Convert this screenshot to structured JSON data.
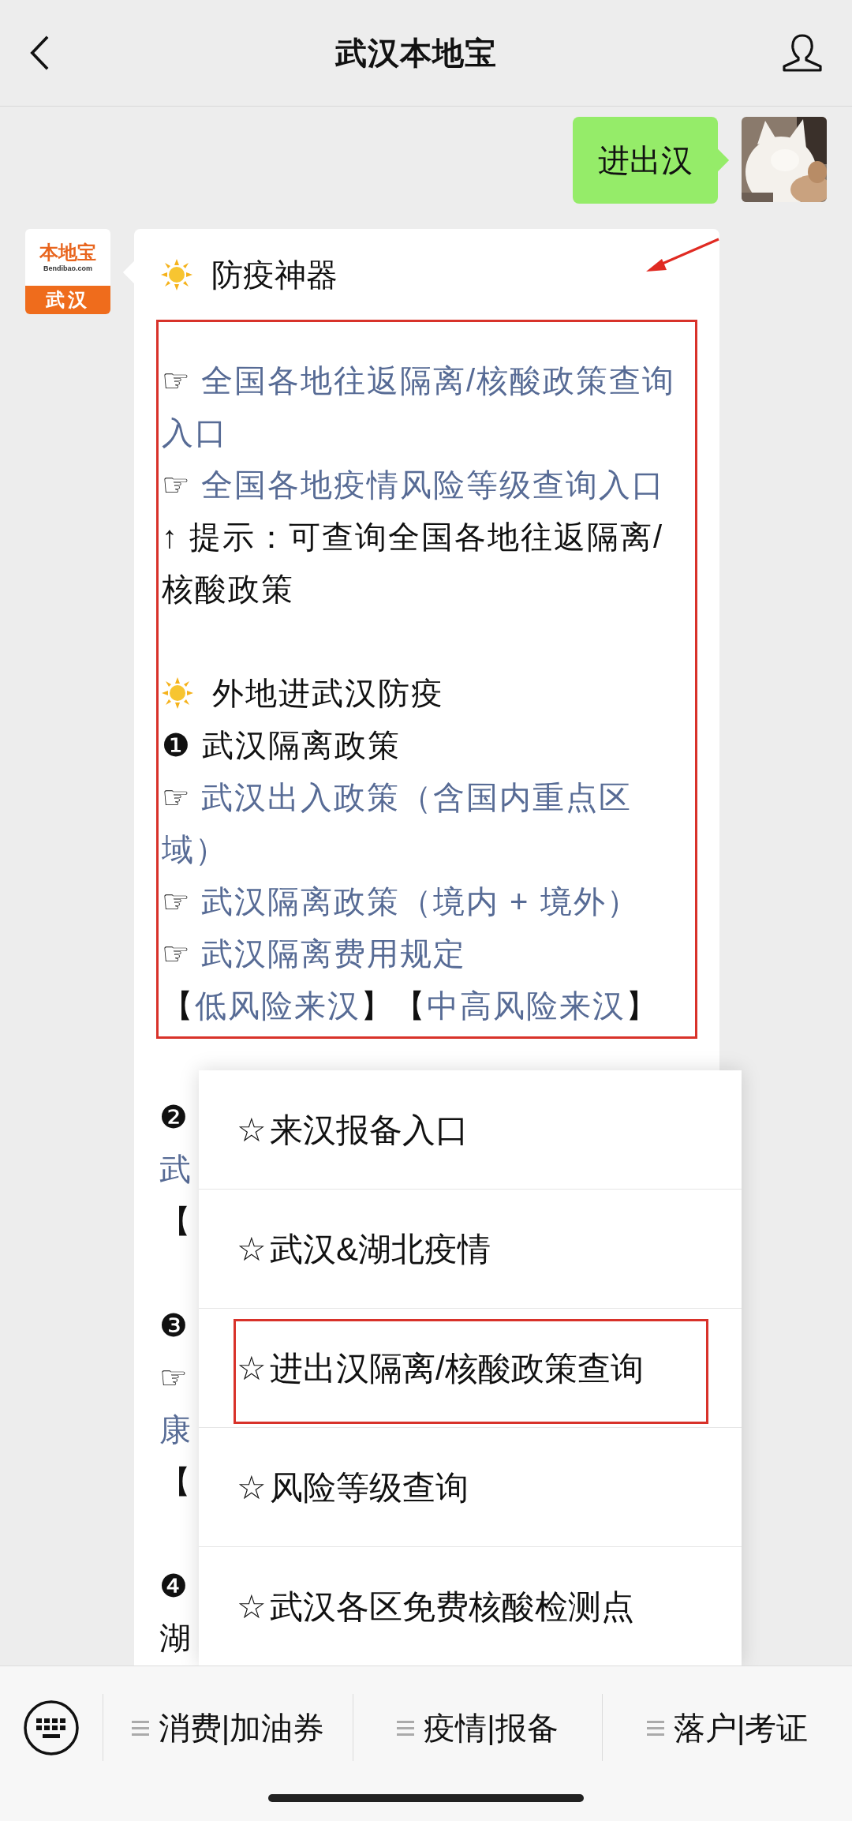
{
  "header": {
    "title": "武汉本地宝"
  },
  "sent_message": {
    "text": "进出汉"
  },
  "reply": {
    "logo": {
      "name": "本地宝",
      "site": "Bendibao.com",
      "city": "武汉"
    },
    "heading": "防疫神器",
    "highlighted_lines": [
      {
        "kind": "link",
        "prefix": "☞",
        "text": "全国各地往返隔离/核酸政策查询入口"
      },
      {
        "kind": "link",
        "prefix": "☞",
        "text": "全国各地疫情风险等级查询入口"
      },
      {
        "kind": "text",
        "text": "↑ 提示：可查询全国各地往返隔离/核酸政策"
      },
      {
        "kind": "blank"
      },
      {
        "kind": "heading",
        "text": "外地进武汉防疫"
      },
      {
        "kind": "text",
        "text": "❶ 武汉隔离政策"
      },
      {
        "kind": "link",
        "prefix": "☞",
        "text": "武汉出入政策（含国内重点区域）"
      },
      {
        "kind": "link",
        "prefix": "☞",
        "text": "武汉隔离政策（境内 + 境外）"
      },
      {
        "kind": "link",
        "prefix": "☞",
        "text": "武汉隔离费用规定"
      },
      {
        "kind": "parts",
        "parts": [
          {
            "text": "【",
            "kind": "text"
          },
          {
            "text": "低风险来汉",
            "kind": "link"
          },
          {
            "text": "】【",
            "kind": "text"
          },
          {
            "text": "中高风险来汉",
            "kind": "link"
          },
          {
            "text": "】",
            "kind": "text"
          }
        ]
      }
    ],
    "lines": [
      {
        "kind": "blank"
      },
      {
        "kind": "text",
        "text": "❷"
      },
      {
        "kind": "parts",
        "parts": [
          {
            "text": "武",
            "kind": "link"
          }
        ]
      },
      {
        "kind": "text",
        "text": "【"
      },
      {
        "kind": "blank"
      },
      {
        "kind": "text",
        "text": "❸"
      },
      {
        "kind": "text",
        "text": "☞"
      },
      {
        "kind": "parts",
        "parts": [
          {
            "text": "康",
            "kind": "link"
          }
        ]
      },
      {
        "kind": "text",
        "text": "【"
      },
      {
        "kind": "blank"
      },
      {
        "kind": "text",
        "text": "❹"
      },
      {
        "kind": "text",
        "text": "湖"
      }
    ]
  },
  "popup_menu": {
    "items": [
      {
        "icon": "☆",
        "label": "来汉报备入口",
        "highlighted": false
      },
      {
        "icon": "☆",
        "label": "武汉&湖北疫情",
        "highlighted": false
      },
      {
        "icon": "☆",
        "label": "进出汉隔离/核酸政策查询",
        "highlighted": true
      },
      {
        "icon": "☆",
        "label": "风险等级查询",
        "highlighted": false
      },
      {
        "icon": "☆",
        "label": "武汉各区免费核酸检测点",
        "highlighted": false
      }
    ]
  },
  "bottom_menu": {
    "items": [
      {
        "label": "消费|加油券"
      },
      {
        "label": "疫情|报备"
      },
      {
        "label": "落户|考证"
      }
    ]
  }
}
